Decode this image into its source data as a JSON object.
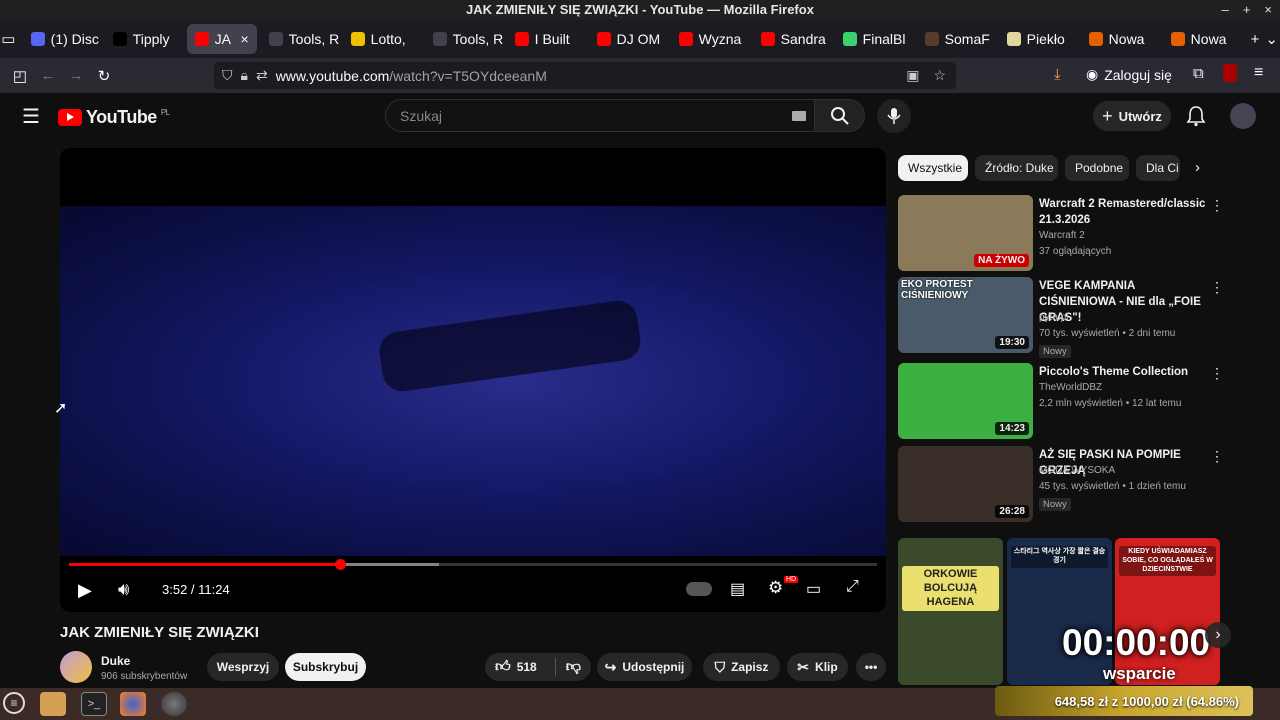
{
  "window": {
    "title": "JAK ZMIENIŁY SIĘ ZWIĄZKI - YouTube — Mozilla Firefox",
    "controls": [
      "–",
      "+",
      "×"
    ]
  },
  "tabs": [
    {
      "label": "(1) Disc",
      "color": "#5865f2"
    },
    {
      "label": "Tipply",
      "color": "#000000"
    },
    {
      "label": "JA",
      "color": "#ff0000",
      "active": true
    },
    {
      "label": "Tools, Re",
      "color": "#42414d"
    },
    {
      "label": "Lotto,",
      "color": "#f0c000"
    },
    {
      "label": "Tools, Re",
      "color": "#42414d"
    },
    {
      "label": "I Built",
      "color": "#ff0000"
    },
    {
      "label": "DJ OM",
      "color": "#ff0000"
    },
    {
      "label": "Wyzna",
      "color": "#ff0000"
    },
    {
      "label": "Sandra",
      "color": "#ff0000"
    },
    {
      "label": "FinalBl",
      "color": "#3bd16f"
    },
    {
      "label": "SomaF",
      "color": "#5a3a2a"
    },
    {
      "label": "Piekło",
      "color": "#e0d8a0"
    },
    {
      "label": "Nowa",
      "color": "#e66000"
    },
    {
      "label": "Nowa",
      "color": "#e66000"
    }
  ],
  "nav": {
    "url_host": "www.youtube.com",
    "url_path": "/watch?v=T5OYdceeanM",
    "signin": "Zaloguj się"
  },
  "youtube": {
    "logo_text": "YouTube",
    "region": "PL",
    "search_placeholder": "Szukaj",
    "create_label": "Utwórz"
  },
  "player": {
    "time": "3:52 / 11:24",
    "progress_played": 0.336,
    "progress_buffered": 0.458,
    "hd_badge": "HD"
  },
  "video": {
    "title": "JAK ZMIENIŁY SIĘ ZWIĄZKI",
    "channel": "Duke",
    "subscribers": "906 subskrybentów",
    "support_label": "Wesprzyj",
    "subscribe_label": "Subskrybuj",
    "likes": "518",
    "share_label": "Udostępnij",
    "save_label": "Zapisz",
    "clip_label": "Klip"
  },
  "chips": [
    "Wszystkie",
    "Źródło: Duke",
    "Podobne",
    "Dla Ci"
  ],
  "recommendations": [
    {
      "title": "Warcraft 2 Remastered/classic 21.3.2026",
      "channel": "Warcraft 2",
      "meta": "37 oglądających",
      "badge": "NA ŻYWO",
      "thumb_color": "#8a7a5a"
    },
    {
      "title": "VEGE KAMPANIA CIŚNIENIOWA - NIE dla „FOIE GRAS\"!",
      "channel": "pyta.pl",
      "meta": "70 tys. wyświetleń • 2 dni temu",
      "duration": "19:30",
      "new": "Nowy",
      "thumb_text": "EKO PROTEST CIŚNIENIOWY",
      "thumb_color": "#4a5a6a"
    },
    {
      "title": "Piccolo's Theme Collection",
      "channel": "TheWorldDBZ",
      "meta": "2,2 mln wyświetleń • 12 lat temu",
      "duration": "14:23",
      "thumb_color": "#3cb043"
    },
    {
      "title": "AŻ SIĘ PASKI NA POMPIE GRZEJĄ",
      "channel": "MODA WYSOKA",
      "meta": "45 tys. wyświetleń • 1 dzień temu",
      "duration": "26:28",
      "new": "Nowy",
      "thumb_color": "#3a2e28"
    }
  ],
  "shorts": [
    {
      "title": "ORKOWIE BOLCUJĄ HAGENA",
      "color": "#3a4a2a"
    },
    {
      "title": "스타리그 역사상 가장 짧은 결승 경기",
      "color": "#1a2a4a"
    },
    {
      "title": "KIEDY UŚWIADAMIASZ SOBIE, CO OGLĄDAŁEŚ W DZIECIŃSTWIE",
      "color": "#d02020"
    }
  ],
  "overlay": {
    "timer": "00:00:00",
    "support": "wsparcie",
    "goal": "648,58 zł z 1000,00 zł (64.86%)"
  }
}
